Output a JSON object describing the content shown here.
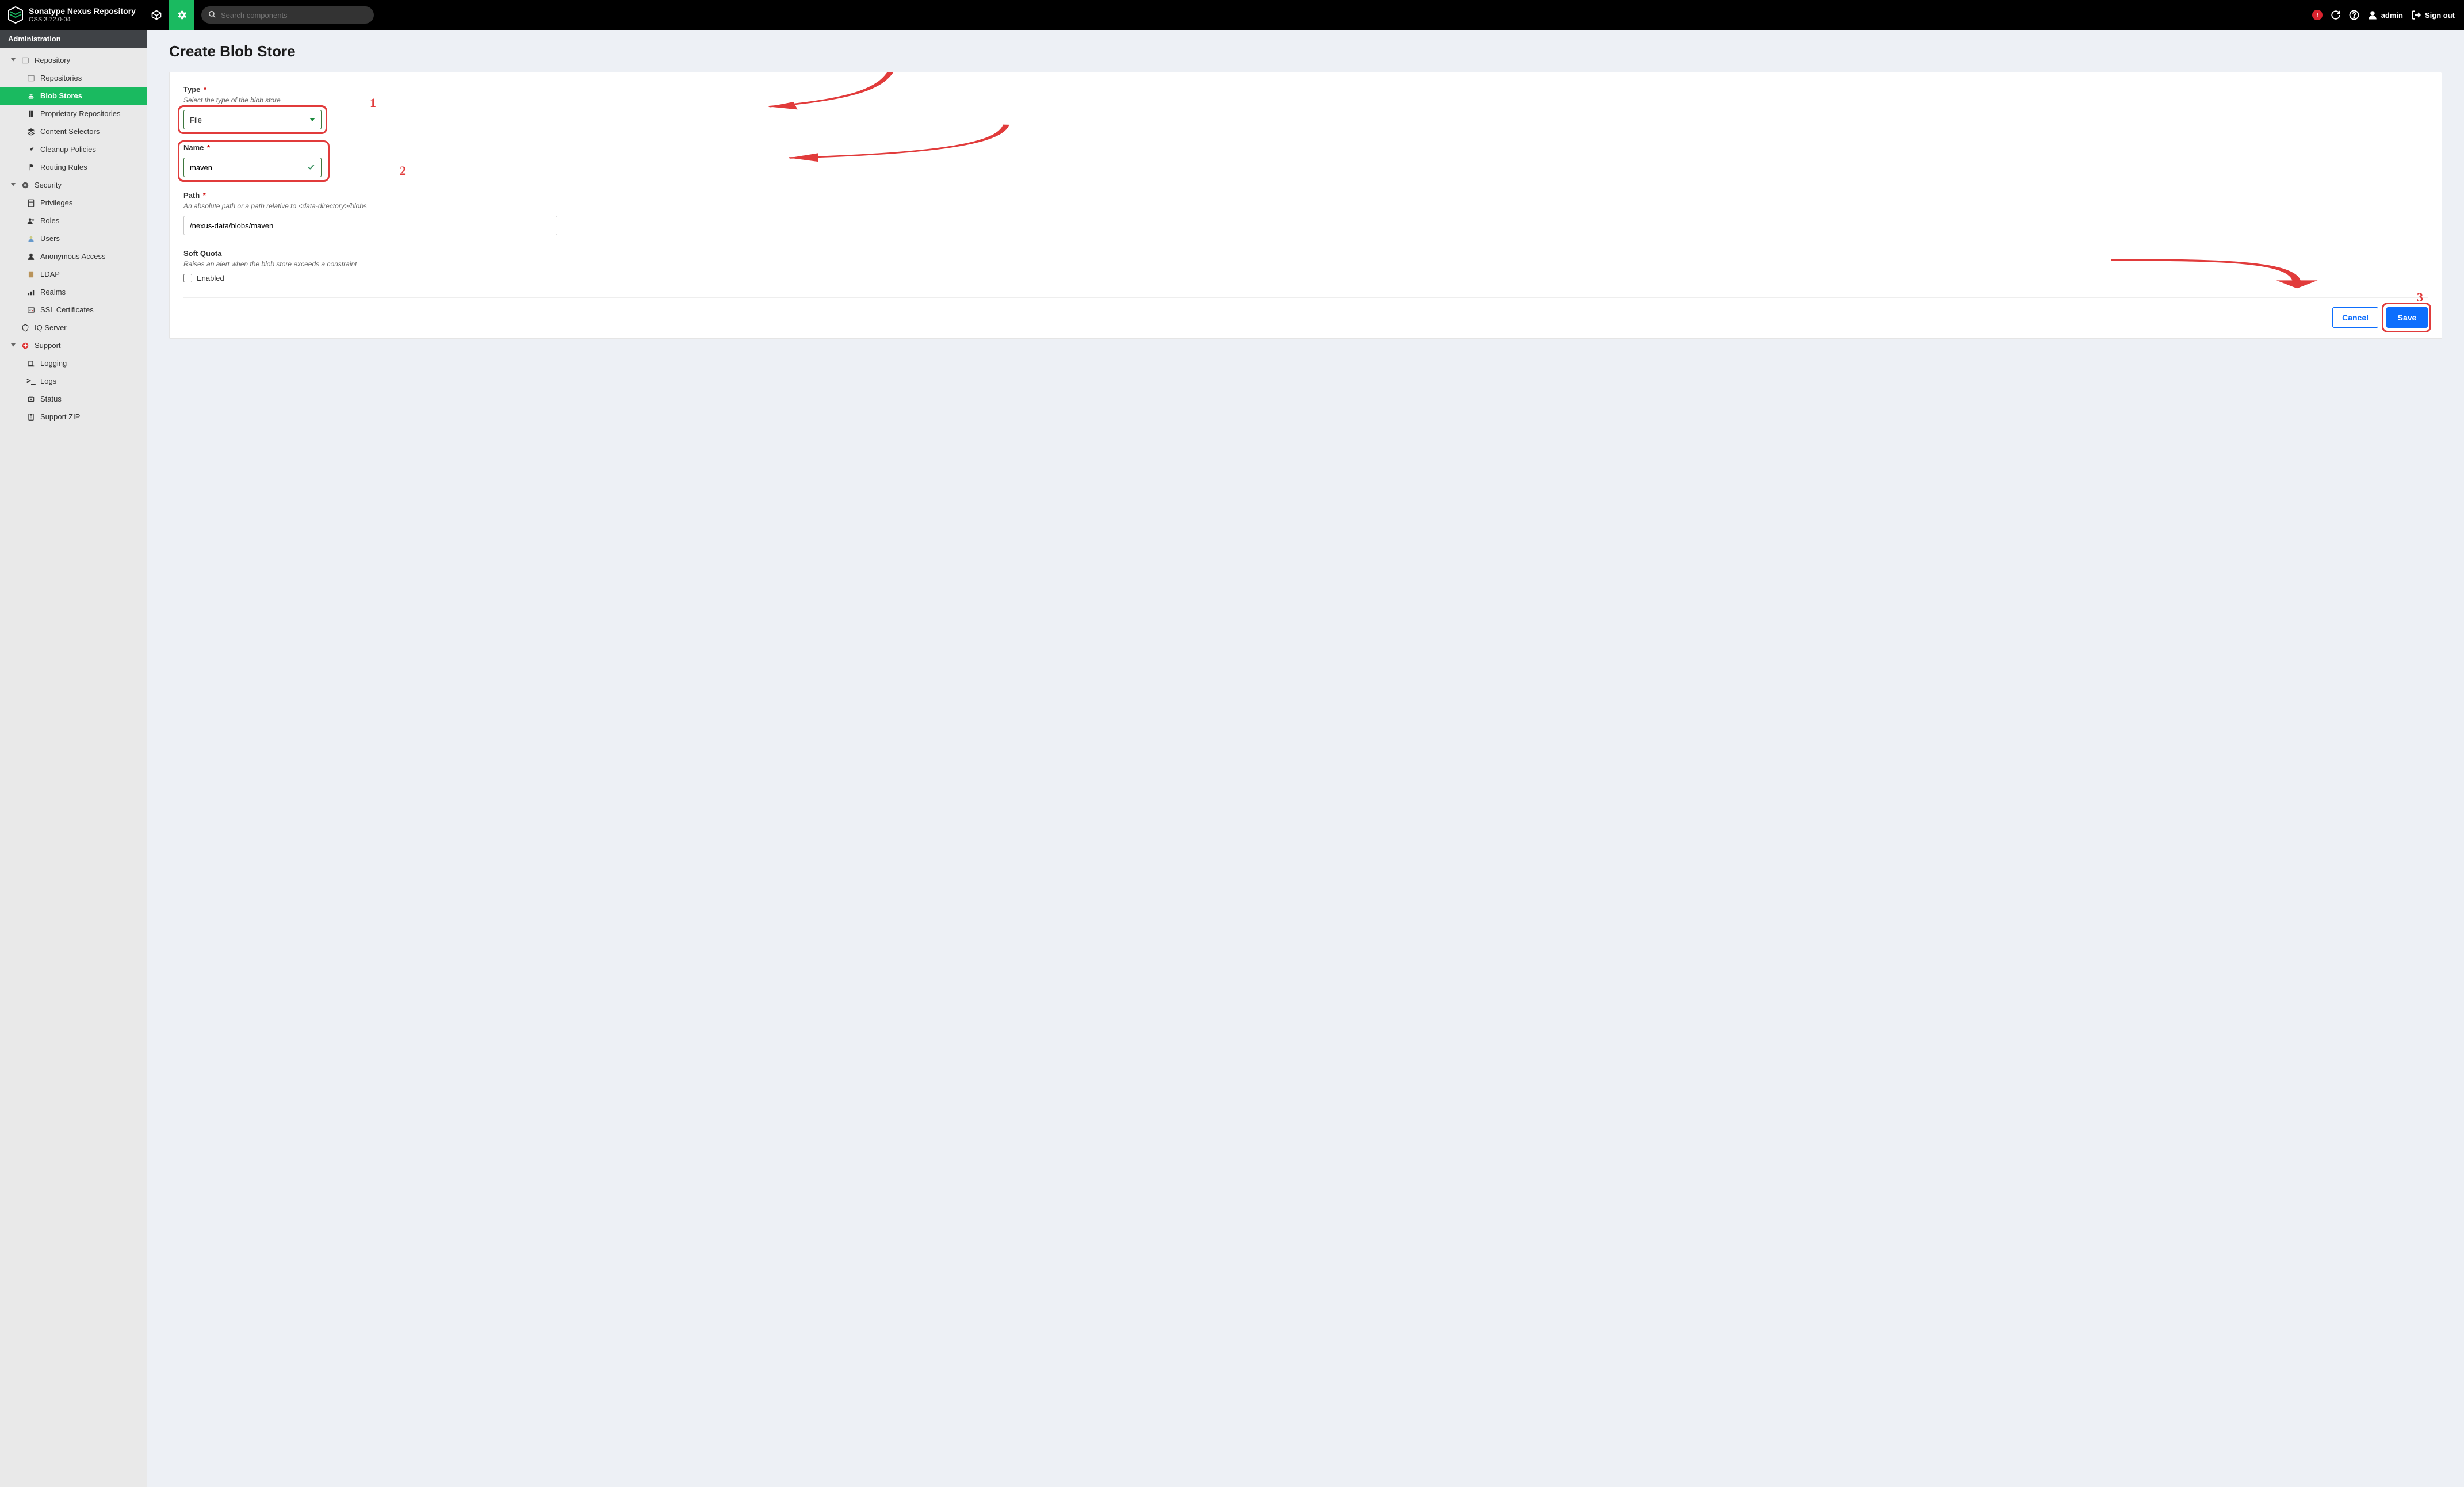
{
  "brand": {
    "title": "Sonatype Nexus Repository",
    "subtitle": "OSS 3.72.0-04"
  },
  "topbar": {
    "search_placeholder": "Search components",
    "user_label": "admin",
    "signout_label": "Sign out"
  },
  "sidebar": {
    "header": "Administration",
    "groups": [
      {
        "label": "Repository",
        "items": [
          {
            "label": "Repositories",
            "active": false
          },
          {
            "label": "Blob Stores",
            "active": true
          },
          {
            "label": "Proprietary Repositories",
            "active": false
          },
          {
            "label": "Content Selectors",
            "active": false
          },
          {
            "label": "Cleanup Policies",
            "active": false
          },
          {
            "label": "Routing Rules",
            "active": false
          }
        ]
      },
      {
        "label": "Security",
        "items": [
          {
            "label": "Privileges"
          },
          {
            "label": "Roles"
          },
          {
            "label": "Users"
          },
          {
            "label": "Anonymous Access"
          },
          {
            "label": "LDAP"
          },
          {
            "label": "Realms"
          },
          {
            "label": "SSL Certificates"
          }
        ]
      },
      {
        "label": "IQ Server",
        "items": []
      },
      {
        "label": "Support",
        "items": [
          {
            "label": "Logging"
          },
          {
            "label": "Logs"
          },
          {
            "label": "Status"
          },
          {
            "label": "Support ZIP"
          }
        ]
      }
    ]
  },
  "page": {
    "title": "Create Blob Store",
    "fields": {
      "type": {
        "label": "Type",
        "hint": "Select the type of the blob store",
        "value": "File"
      },
      "name": {
        "label": "Name",
        "value": "maven"
      },
      "path": {
        "label": "Path",
        "hint": "An absolute path or a path relative to <data-directory>/blobs",
        "value": "/nexus-data/blobs/maven"
      },
      "quota": {
        "label": "Soft Quota",
        "hint": "Raises an alert when the blob store exceeds a constraint",
        "checkbox_label": "Enabled",
        "checked": false
      }
    },
    "buttons": {
      "cancel": "Cancel",
      "save": "Save"
    }
  },
  "annotations": {
    "n1": "1",
    "n2": "2",
    "n3": "3"
  }
}
